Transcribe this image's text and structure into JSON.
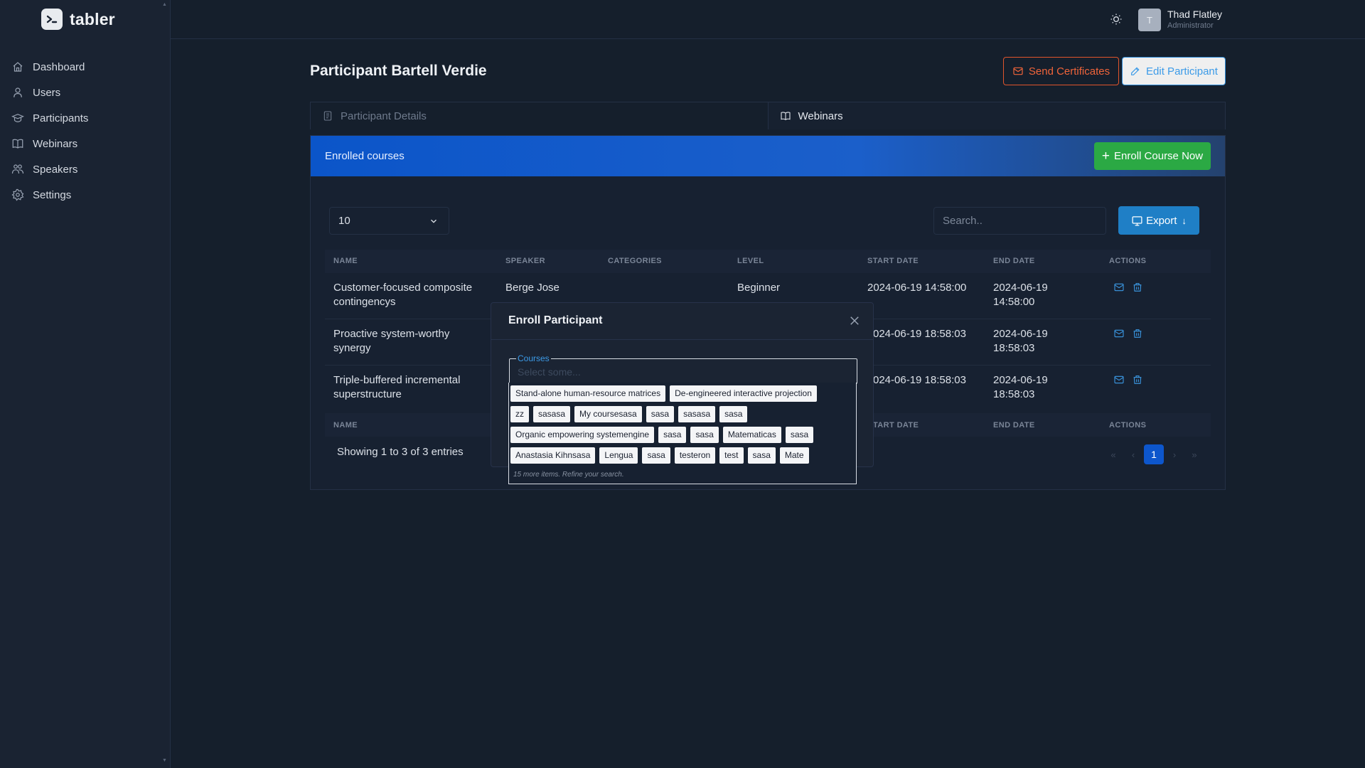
{
  "brand": {
    "name": "tabler"
  },
  "sidebar": {
    "items": [
      {
        "label": "Dashboard",
        "icon": "home-icon"
      },
      {
        "label": "Users",
        "icon": "user-icon"
      },
      {
        "label": "Participants",
        "icon": "graduation-cap-icon"
      },
      {
        "label": "Webinars",
        "icon": "book-icon"
      },
      {
        "label": "Speakers",
        "icon": "users-group-icon"
      },
      {
        "label": "Settings",
        "icon": "gear-icon"
      }
    ]
  },
  "header": {
    "user_initial": "T",
    "user_name": "Thad Flatley",
    "user_role": "Administrator"
  },
  "page": {
    "title": "Participant Bartell Verdie",
    "send_label": "Send Certificates",
    "edit_label": "Edit Participant"
  },
  "tabs": [
    {
      "label": "Participant Details",
      "active": false
    },
    {
      "label": "Webinars",
      "active": true
    }
  ],
  "card": {
    "title": "Enrolled courses",
    "enroll_label": "Enroll Course Now",
    "per_page": "10",
    "search_placeholder": "Search..",
    "export_label": "Export"
  },
  "table": {
    "headers": [
      "Name",
      "Speaker",
      "Categories",
      "Level",
      "Start date",
      "End date",
      "Actions"
    ],
    "rows": [
      {
        "name_1": "Customer-focused composite",
        "name_2": "contingencys",
        "speaker": "Berge Jose",
        "categories": "",
        "level": "Beginner",
        "start": "2024-06-19 14:58:00",
        "end_1": "2024-06-19",
        "end_2": "14:58:00"
      },
      {
        "name_1": "Proactive system-worthy",
        "name_2": "synergy",
        "speaker": "",
        "categories": "",
        "level": "",
        "start": "024-06-19 18:58:03",
        "end_1": "2024-06-19",
        "end_2": "18:58:03"
      },
      {
        "name_1": "Triple-buffered incremental",
        "name_2": "superstructure",
        "speaker": "",
        "categories": "",
        "level": "",
        "start": "024-06-19 18:58:03",
        "end_1": "2024-06-19",
        "end_2": "18:58:03"
      }
    ],
    "footer": [
      "Name",
      "tart date",
      "End date",
      "Actions"
    ],
    "showing": "Showing 1 to 3 of 3 entries",
    "current_page": "1"
  },
  "modal": {
    "title": "Enroll Participant",
    "field_label": "Courses",
    "field_placeholder": "Select some...",
    "chip_rows": [
      [
        "Stand-alone human-resource matrices",
        "De-engineered interactive projection"
      ],
      [
        "zz",
        "sasasa",
        "My coursesasa",
        "sasa",
        "sasasa",
        "sasa"
      ],
      [
        "Organic empowering systemengine",
        "sasa",
        "sasa",
        "Matematicas",
        "sasa"
      ],
      [
        "Anastasia Kihnsasa",
        "Lengua",
        "sasa",
        "testeron",
        "test",
        "sasa",
        "Mate"
      ]
    ],
    "more_items": "15 more items. Refine your search."
  },
  "colors": {
    "background": "#151f2c",
    "sidebar": "#1a2332",
    "accent_blue": "#0d56cc",
    "success": "#2ba944",
    "danger_outline": "#e0552c",
    "info": "#1f7fc6"
  }
}
